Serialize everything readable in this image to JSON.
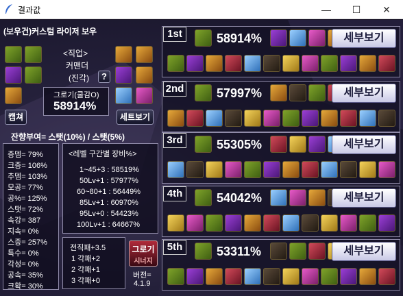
{
  "window": {
    "title": "결과값",
    "min": "—",
    "max": "☐",
    "close": "✕"
  },
  "header": {
    "char_name": "(보우건)커스텀 라이저 보우"
  },
  "job": {
    "label": "<직업>",
    "name": "커맨더",
    "sub": "(진각)",
    "help": "?"
  },
  "score": {
    "label": "그로기(쿨감O)",
    "value": "58914%"
  },
  "buttons": {
    "capture": "캡쳐",
    "set_view": "세트보기",
    "detail": "세부보기",
    "groggy1": "그로기",
    "groggy2": "시너지"
  },
  "stat_line": "잔향부여= 스탯(10%) / 스탯(5%)",
  "stats": [
    "증뎀= 79%",
    "크증= 106%",
    "추뎀= 103%",
    "모공= 77%",
    "공%= 125%",
    "스탯= 72%",
    "속강= 387",
    "지속= 0%",
    "스증= 257%",
    "특수= 0%",
    "각성= 0%",
    "공속= 35%",
    "크확= 30%"
  ],
  "level_section": {
    "title": "<레벨 구간별 장비%>",
    "rows": [
      "1~45+3 : 58519%",
      "50Lv+1 : 57977%",
      "60~80+1 : 56449%",
      "85Lv+1 : 60970%",
      "95Lv+0 : 54423%",
      "100Lv+1 : 64667%"
    ]
  },
  "jeonjik": [
    "전직패+3.5",
    "1 각패+2",
    "2 각패+1",
    "3 각패+0"
  ],
  "version": {
    "label": "버전=",
    "value": "4.1.9"
  },
  "results": [
    {
      "rank": "1st",
      "pct": "58914%"
    },
    {
      "rank": "2nd",
      "pct": "57997%"
    },
    {
      "rank": "3rd",
      "pct": "55305%"
    },
    {
      "rank": "4th",
      "pct": "54042%"
    },
    {
      "rank": "5th",
      "pct": "53311%"
    }
  ],
  "icons": [
    "feather-icon",
    "equipment-icon"
  ]
}
